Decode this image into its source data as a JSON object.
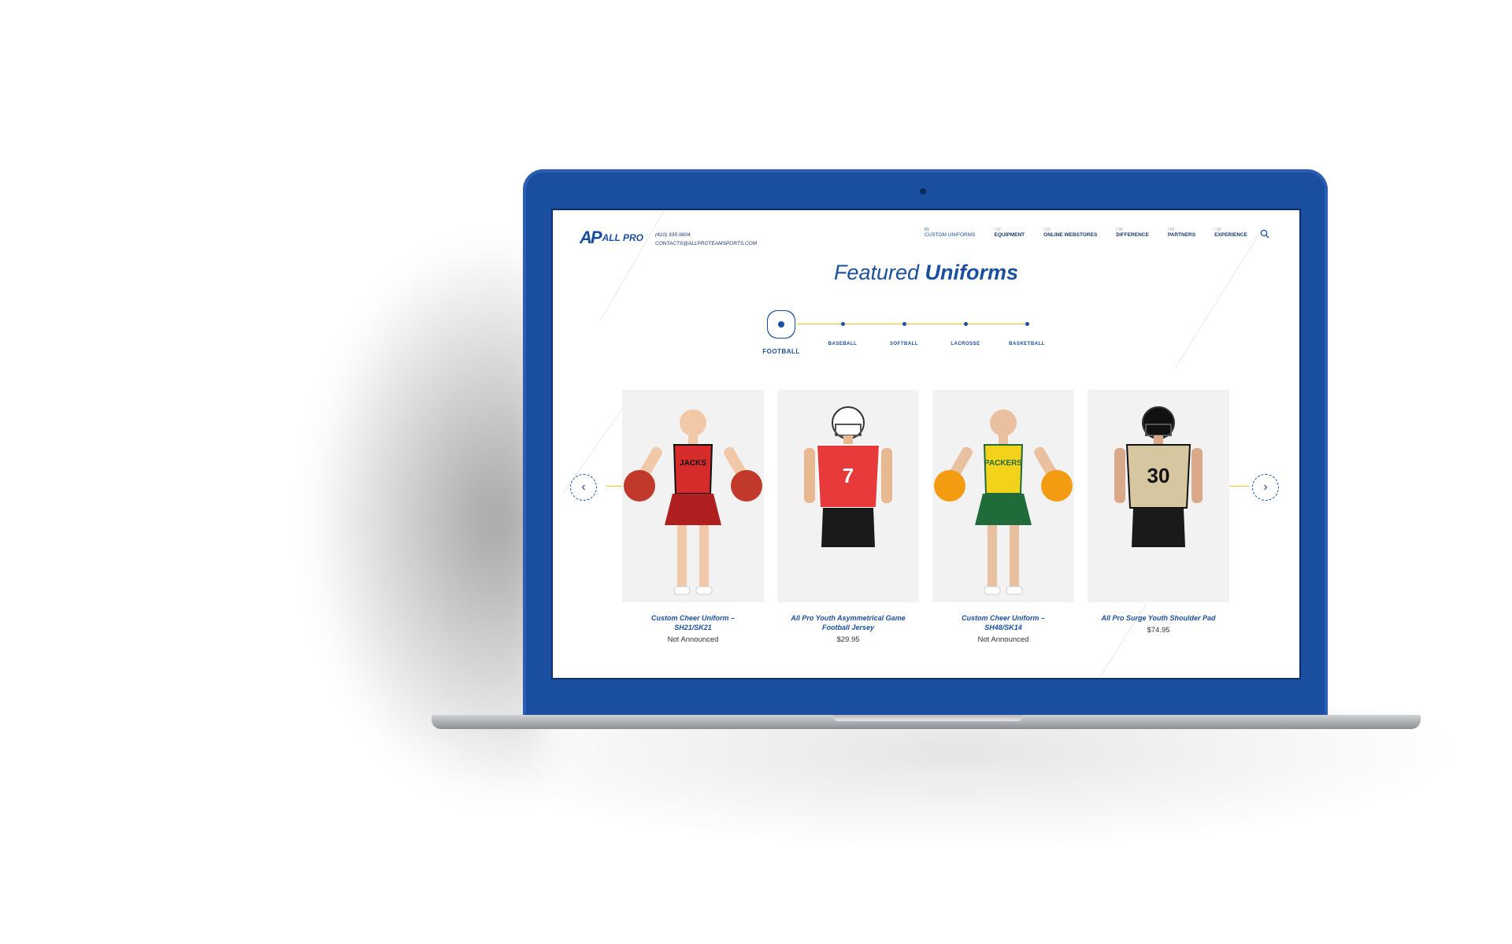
{
  "site": {
    "logo_mark": "AP",
    "logo_text": "ALL PRO",
    "phone": "(410) 335-9804",
    "email": "CONTACTS@ALLPROTEAMSPORTS.COM"
  },
  "nav": [
    {
      "num": "01",
      "label": "CUSTOM UNIFORMS"
    },
    {
      "num": "/ 02",
      "label": "EQUIPMENT"
    },
    {
      "num": "/ 03",
      "label": "ONLINE WEBSTORES"
    },
    {
      "num": "/ 04",
      "label": "DIFFERENCE"
    },
    {
      "num": "/ 05",
      "label": "PARTNERS"
    },
    {
      "num": "/ 06",
      "label": "EXPERIENCE"
    }
  ],
  "heading": {
    "light": "Featured",
    "bold": "Uniforms"
  },
  "tabs": [
    "FOOTBALL",
    "BASEBALL",
    "SOFTBALL",
    "LACROSSE",
    "BASKETBALL"
  ],
  "products": [
    {
      "name": "Custom Cheer Uniform – SH21/SK21",
      "price": "Not Announced",
      "top": "#d62b2b",
      "bottom": "#b01f1f",
      "trim": "#111111",
      "skin": "#f1c9a8",
      "poms": "#c0392b",
      "jersey_text": "JACKS"
    },
    {
      "name": "All Pro Youth Asymmetrical Game Football Jersey",
      "price": "$29.95",
      "top": "#e8393b",
      "bottom": "#1a1a1a",
      "trim": "#ffffff",
      "skin": "#e8b890",
      "poms": "",
      "jersey_text": "7"
    },
    {
      "name": "Custom Cheer Uniform – SH48/SK14",
      "price": "Not Announced",
      "top": "#f2d21a",
      "bottom": "#1f6b3a",
      "trim": "#1f6b3a",
      "skin": "#e9c0a0",
      "poms": "#f39c12",
      "jersey_text": "PACKERS"
    },
    {
      "name": "All Pro Surge Youth Shoulder Pad",
      "price": "$74.95",
      "top": "#d6c7a0",
      "bottom": "#1a1a1a",
      "trim": "#111111",
      "skin": "#d9a98a",
      "poms": "",
      "jersey_text": "30"
    }
  ],
  "colors": {
    "brand": "#1a4fa0",
    "accent": "#f0c419"
  }
}
